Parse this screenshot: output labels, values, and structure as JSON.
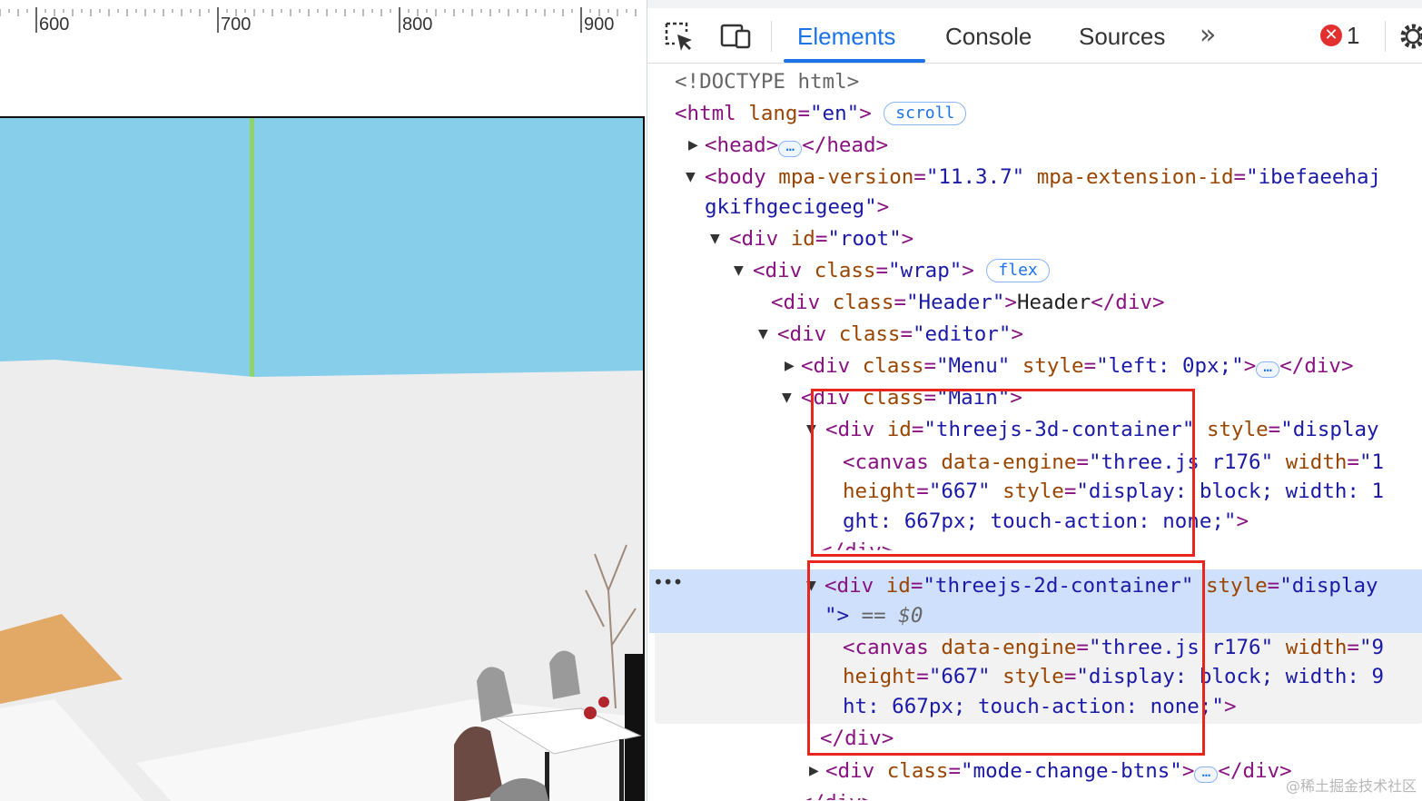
{
  "ruler": {
    "labels": [
      "600",
      "700",
      "800",
      "900"
    ]
  },
  "toolbar": {
    "tabs": [
      "Elements",
      "Console",
      "Sources"
    ],
    "more": "»",
    "error_count": "1"
  },
  "tree": {
    "doctype": "<!DOCTYPE html>",
    "html_open": "<html",
    "html_attr": "lang",
    "html_val": "\"en\"",
    "html_badge": "scroll",
    "head_open": "<head>",
    "head_close": "</head>",
    "body_open": "<body",
    "body_attr1": "mpa-version",
    "body_val1": "\"11.3.7\"",
    "body_attr2": "mpa-extension-id",
    "body_val2a": "\"ibefaeehaj",
    "body_val2b": "gkifhgecigeeg\"",
    "div": "<div",
    "id_attr": "id",
    "class_attr": "class",
    "style_attr": "style",
    "root_val": "\"root\"",
    "wrap_val": "\"wrap\"",
    "wrap_badge": "flex",
    "header_val": "\"Header\"",
    "header_text": "Header",
    "div_close": "</div>",
    "editor_val": "\"editor\"",
    "menu_val": "\"Menu\"",
    "menu_style": "\"left: 0px;\"",
    "main_val": "\"Main\"",
    "c3d_val": "\"threejs-3d-container\"",
    "display_partial": "\"display",
    "canvas_open": "<canvas",
    "engine_attr": "data-engine",
    "engine_val": "\"three.js r176\"",
    "width_attr": "width",
    "width_val_3d": "\"1",
    "width_val_2d": "\"9",
    "height_attr": "height",
    "height_val": "\"667\"",
    "canvas_style_start": "\"display: block; width: 1",
    "canvas_style_start_2d": "\"display: block; width: 9",
    "canvas_style_end_3d": "ght: 667px; touch-action: none;\"",
    "canvas_style_end_2d": "ht: 667px; touch-action: none;\"",
    "c2d_val": "\"threejs-2d-container\"",
    "sel_close": "\">",
    "sel_marker": "== $0",
    "mode_val": "\"mode-change-btns\"",
    "partial_close": "</div>"
  },
  "watermark": "@稀土掘金技术社区",
  "colors": {
    "sky": "#87ceeb",
    "floor": "#ededee",
    "wood": "#e2a866",
    "accent": "#1a73e8",
    "highlight": "#e8261d"
  }
}
